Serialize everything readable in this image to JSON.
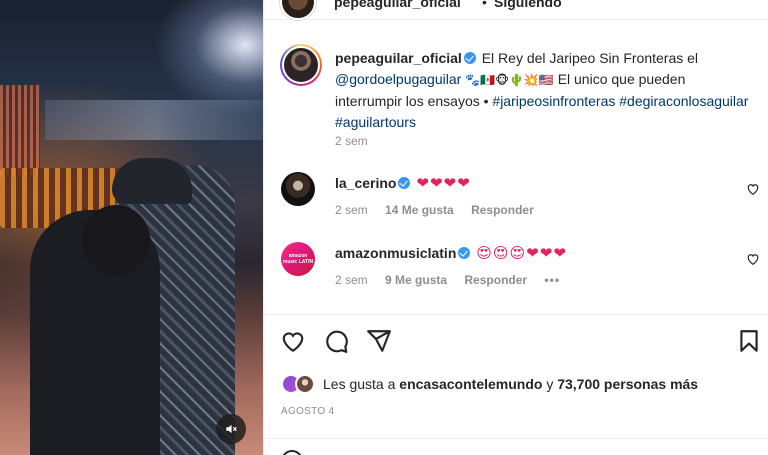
{
  "post": {
    "username": "pepeaguilar_oficial",
    "dot": "•",
    "follow_state": "Siguiendo"
  },
  "caption": {
    "username": "pepeaguilar_oficial",
    "text_1": "El Rey del Jaripeo Sin Fronteras el",
    "mention": "@gordoelpugaguilar",
    "emojis": "🐾🇲🇽🐵🌵💥🇺🇸",
    "text_2": "El unico que pueden interrumpir los ensayos •",
    "hashtag_1": "#jaripeosinfronteras",
    "hashtag_2": "#degiraconlosaguilar",
    "hashtag_3": "#aguilartours",
    "time": "2 sem"
  },
  "comments": [
    {
      "username": "la_cerino",
      "text": "❤❤❤❤",
      "time": "2 sem",
      "likes": "14 Me gusta",
      "reply": "Responder"
    },
    {
      "username": "amazonmusiclatin",
      "avatar_label": "amazon music LATIN",
      "text": "😍😍😍❤❤❤",
      "time": "2 sem",
      "likes": "9 Me gusta",
      "reply": "Responder",
      "more": "•••"
    }
  ],
  "likes_row": {
    "prefix": "Les gusta a",
    "user": "encasacontelemundo",
    "connector": "y",
    "count": "73,700 personas más"
  },
  "date": "AGOSTO 4",
  "icons": [
    "verified-icon",
    "heart-icon",
    "comment-icon",
    "share-icon",
    "bookmark-icon",
    "mute-icon",
    "more-icon"
  ],
  "colors": {
    "verified": "#3897f0",
    "link": "#00376b",
    "muted": "#8e8e8e",
    "heart": "#e0245e"
  }
}
